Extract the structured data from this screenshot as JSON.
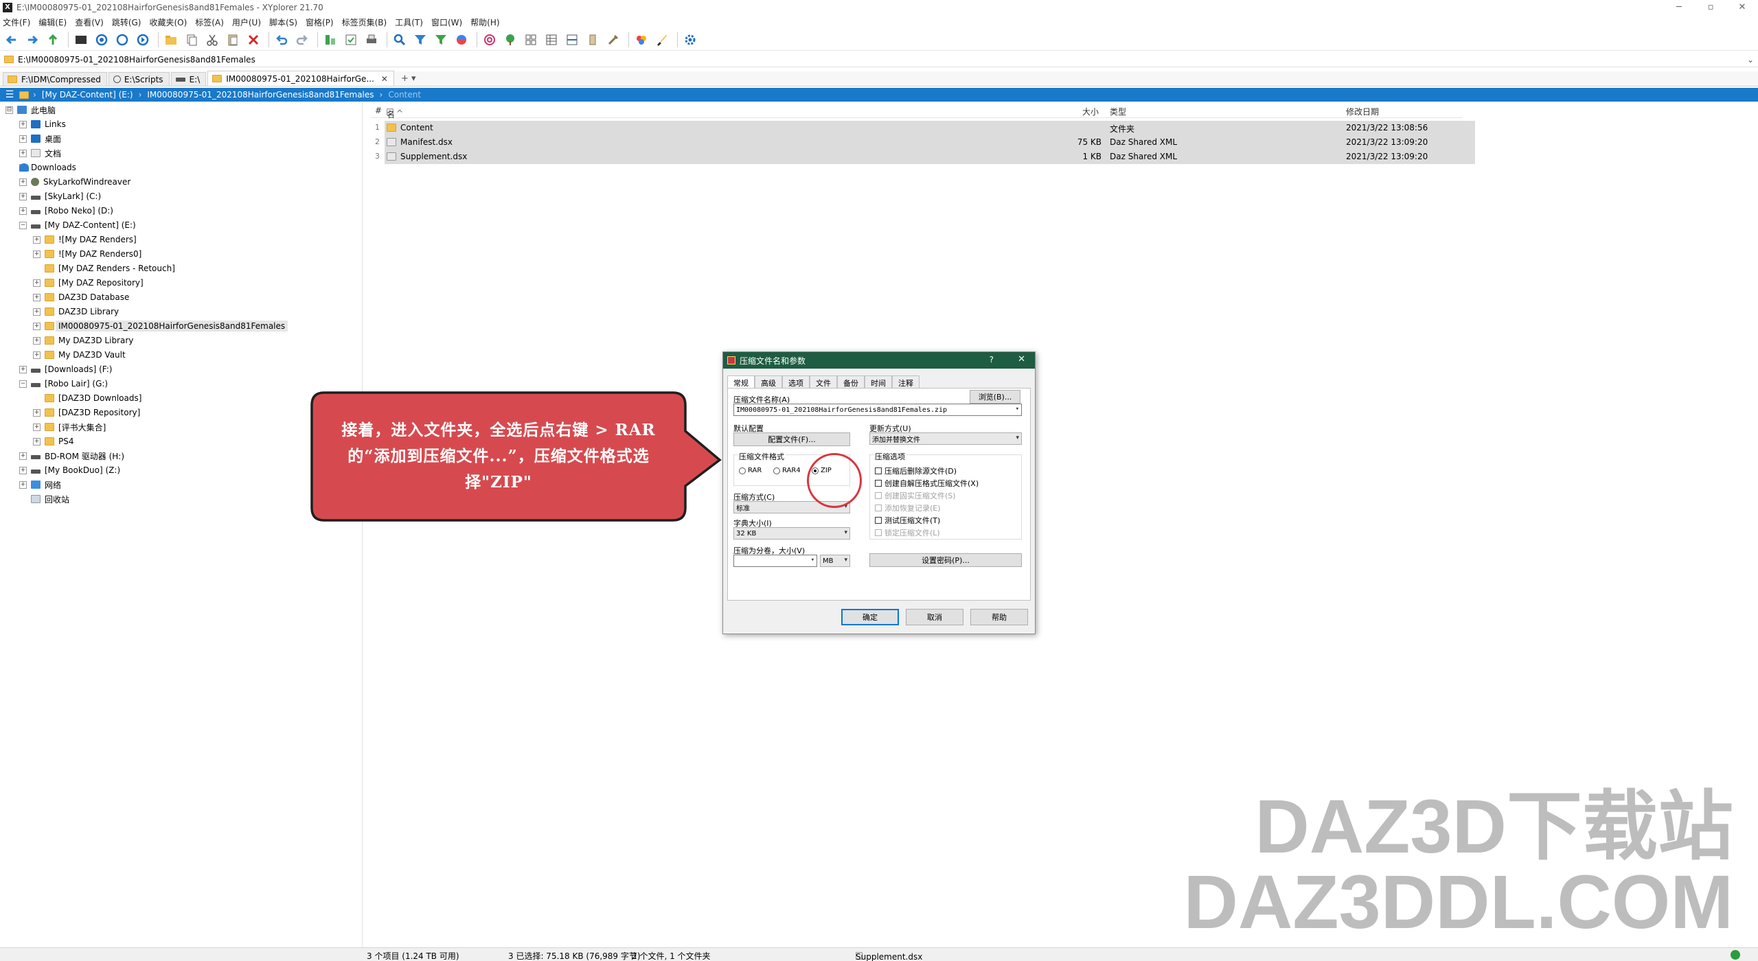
{
  "window": {
    "title": "E:\\IM00080975-01_202108HairforGenesis8and81Females - XYplorer 21.70",
    "app_glyph": "X",
    "minimize": "─",
    "restore": "▫",
    "close": "✕"
  },
  "menu": [
    "文件(F)",
    "编辑(E)",
    "查看(V)",
    "跳转(G)",
    "收藏夹(O)",
    "标签(A)",
    "用户(U)",
    "脚本(S)",
    "窗格(P)",
    "标签页集(B)",
    "工具(T)",
    "窗口(W)",
    "帮助(H)"
  ],
  "address": {
    "path": "E:\\IM00080975-01_202108HairforGenesis8and81Females",
    "dropdown": "⌄"
  },
  "tabs": [
    {
      "label": "F:\\IDM\\Compressed"
    },
    {
      "label": "E:\\Scripts"
    },
    {
      "label": "E:\\"
    },
    {
      "label": "IM00080975-01_202108HairforGe...",
      "close": "✕"
    }
  ],
  "tab_new": "+  ▾",
  "breadcrumb": {
    "menu_glyph": "☰",
    "sep": "›",
    "drive": "[My DAZ-Content] (E:)",
    "folder": "IM00080975-01_202108HairforGenesis8and81Females",
    "sub": "Content"
  },
  "tree": [
    {
      "label": "此电脑",
      "icon": "pc",
      "exp": "⊟",
      "depth": 0
    },
    {
      "label": "Links",
      "icon": "blue",
      "exp": "+",
      "depth": 1
    },
    {
      "label": "桌面",
      "icon": "blue",
      "exp": "+",
      "depth": 1
    },
    {
      "label": "文档",
      "icon": "doc",
      "exp": "+",
      "depth": 1
    },
    {
      "label": "Downloads",
      "icon": "dl",
      "exp": "+",
      "depth": 1
    },
    {
      "label": "SkyLarkofWindreaver",
      "icon": "user",
      "exp": "+",
      "depth": 1
    },
    {
      "label": "[SkyLark] (C:)",
      "icon": "drive",
      "exp": "+",
      "depth": 1
    },
    {
      "label": "[Robo Neko] (D:)",
      "icon": "drive",
      "exp": "+",
      "depth": 1
    },
    {
      "label": "[My DAZ-Content] (E:)",
      "icon": "drive",
      "exp": "−",
      "depth": 1
    },
    {
      "label": "![My DAZ Renders]",
      "icon": "folder",
      "exp": "+",
      "depth": 2
    },
    {
      "label": "![My DAZ Renders0]",
      "icon": "folder",
      "exp": "+",
      "depth": 2
    },
    {
      "label": "[My DAZ Renders - Retouch]",
      "icon": "folder",
      "exp": "",
      "depth": 2
    },
    {
      "label": "[My DAZ Repository]",
      "icon": "folder",
      "exp": "+",
      "depth": 2
    },
    {
      "label": "DAZ3D Database",
      "icon": "folder",
      "exp": "+",
      "depth": 2
    },
    {
      "label": "DAZ3D Library",
      "icon": "folder",
      "exp": "+",
      "depth": 2
    },
    {
      "label": "IM00080975-01_202108HairforGenesis8and81Females",
      "icon": "folder",
      "exp": "+",
      "depth": 2,
      "selected": true
    },
    {
      "label": "My DAZ3D Library",
      "icon": "folder",
      "exp": "+",
      "depth": 2
    },
    {
      "label": "My DAZ3D Vault",
      "icon": "folder",
      "exp": "+",
      "depth": 2
    },
    {
      "label": "[Downloads] (F:)",
      "icon": "drive",
      "exp": "+",
      "depth": 1
    },
    {
      "label": "[Robo Lair] (G:)",
      "icon": "drive",
      "exp": "−",
      "depth": 1
    },
    {
      "label": "[DAZ3D Downloads]",
      "icon": "folder",
      "exp": "",
      "depth": 2
    },
    {
      "label": "[DAZ3D Repository]",
      "icon": "folder",
      "exp": "+",
      "depth": 2
    },
    {
      "label": "[评书大集合]",
      "icon": "folder",
      "exp": "+",
      "depth": 2
    },
    {
      "label": "PS4",
      "icon": "folder",
      "exp": "+",
      "depth": 2
    },
    {
      "label": "BD-ROM 驱动器 (H:)",
      "icon": "drive",
      "exp": "+",
      "depth": 1
    },
    {
      "label": "[My BookDuo] (Z:)",
      "icon": "drive",
      "exp": "+",
      "depth": 1
    },
    {
      "label": "网络",
      "icon": "net",
      "exp": "+",
      "depth": 1
    },
    {
      "label": "回收站",
      "icon": "bin",
      "exp": "",
      "depth": 1
    }
  ],
  "list": {
    "headers": {
      "num": "#",
      "name": "名称",
      "sort": "^",
      "size": "大小",
      "type": "类型",
      "date": "修改日期"
    },
    "rows": [
      {
        "num": "1",
        "name": "Content",
        "size": "",
        "type": "文件夹",
        "date": "2021/3/22 13:08:56",
        "icon": "folder"
      },
      {
        "num": "2",
        "name": "Manifest.dsx",
        "size": "75 KB",
        "type": "Daz Shared XML",
        "date": "2021/3/22 13:09:20",
        "icon": "doc"
      },
      {
        "num": "3",
        "name": "Supplement.dsx",
        "size": "1 KB",
        "type": "Daz Shared XML",
        "date": "2021/3/22 13:09:20",
        "icon": "doc"
      }
    ]
  },
  "callout": {
    "text": "接着，进入文件夹，全选后点右键 > RAR的“添加到压缩文件...”，压缩文件格式选择\"ZIP\"",
    "fill": "#d64a4f",
    "stroke": "#1f1f1f"
  },
  "dialog": {
    "title": "压缩文件名和参数",
    "help": "?",
    "close": "✕",
    "tabs": [
      "常规",
      "高级",
      "选项",
      "文件",
      "备份",
      "时间",
      "注释"
    ],
    "archive_name_label": "压缩文件名称(A)",
    "browse": "浏览(B)...",
    "archive_name": "IM00080975-01_202108HairforGenesis8and81Females.zip",
    "profile_label": "默认配置",
    "profile_btn": "配置文件(F)...",
    "update_label": "更新方式(U)",
    "update_value": "添加并替换文件",
    "format_label": "压缩文件格式",
    "formats": [
      {
        "label": "RAR",
        "checked": false
      },
      {
        "label": "RAR4",
        "checked": false
      },
      {
        "label": "ZIP",
        "checked": true
      }
    ],
    "method_label": "压缩方式(C)",
    "method_value": "标准",
    "dict_label": "字典大小(I)",
    "dict_value": "32 KB",
    "split_label": "压缩为分卷，大小(V)",
    "split_unit": "MB",
    "options_label": "压缩选项",
    "options": [
      {
        "label": "压缩后删除源文件(D)",
        "disabled": false
      },
      {
        "label": "创建自解压格式压缩文件(X)",
        "disabled": false
      },
      {
        "label": "创建固实压缩文件(S)",
        "disabled": true
      },
      {
        "label": "添加恢复记录(E)",
        "disabled": true
      },
      {
        "label": "测试压缩文件(T)",
        "disabled": false
      },
      {
        "label": "锁定压缩文件(L)",
        "disabled": true
      }
    ],
    "password_btn": "设置密码(P)...",
    "ok": "确定",
    "cancel": "取消",
    "help_btn": "帮助"
  },
  "status": {
    "items": "3 个项目 (1.24 TB 可用)",
    "selected": "3 已选择: 75.18 KB (76,989 字节)",
    "counts": "2 个文件, 1 个文件夹",
    "current": "Supplement.dsx"
  },
  "watermark": {
    "line1": "DAZ3D下载站",
    "line2": "DAZ3DDL.COM"
  }
}
